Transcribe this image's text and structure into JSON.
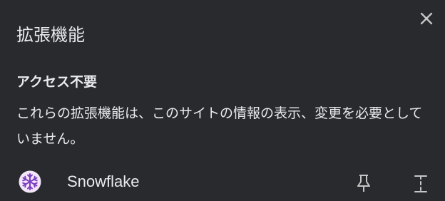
{
  "popup": {
    "title": "拡張機能",
    "close_icon": "close-icon"
  },
  "section": {
    "heading": "アクセス不要",
    "description": "これらの拡張機能は、このサイトの情報の表示、変更を必要としていません。"
  },
  "extensions": [
    {
      "name": "Snowflake",
      "icon": "snowflake-icon",
      "icon_bg": "#f3e6fb",
      "icon_fg": "#7b3fbf",
      "pin_icon": "pin-icon",
      "menu_icon": "more-vertical-icon"
    }
  ],
  "colors": {
    "background": "#292a2d",
    "text": "#e8eaed",
    "icon": "#c4c7c5"
  }
}
